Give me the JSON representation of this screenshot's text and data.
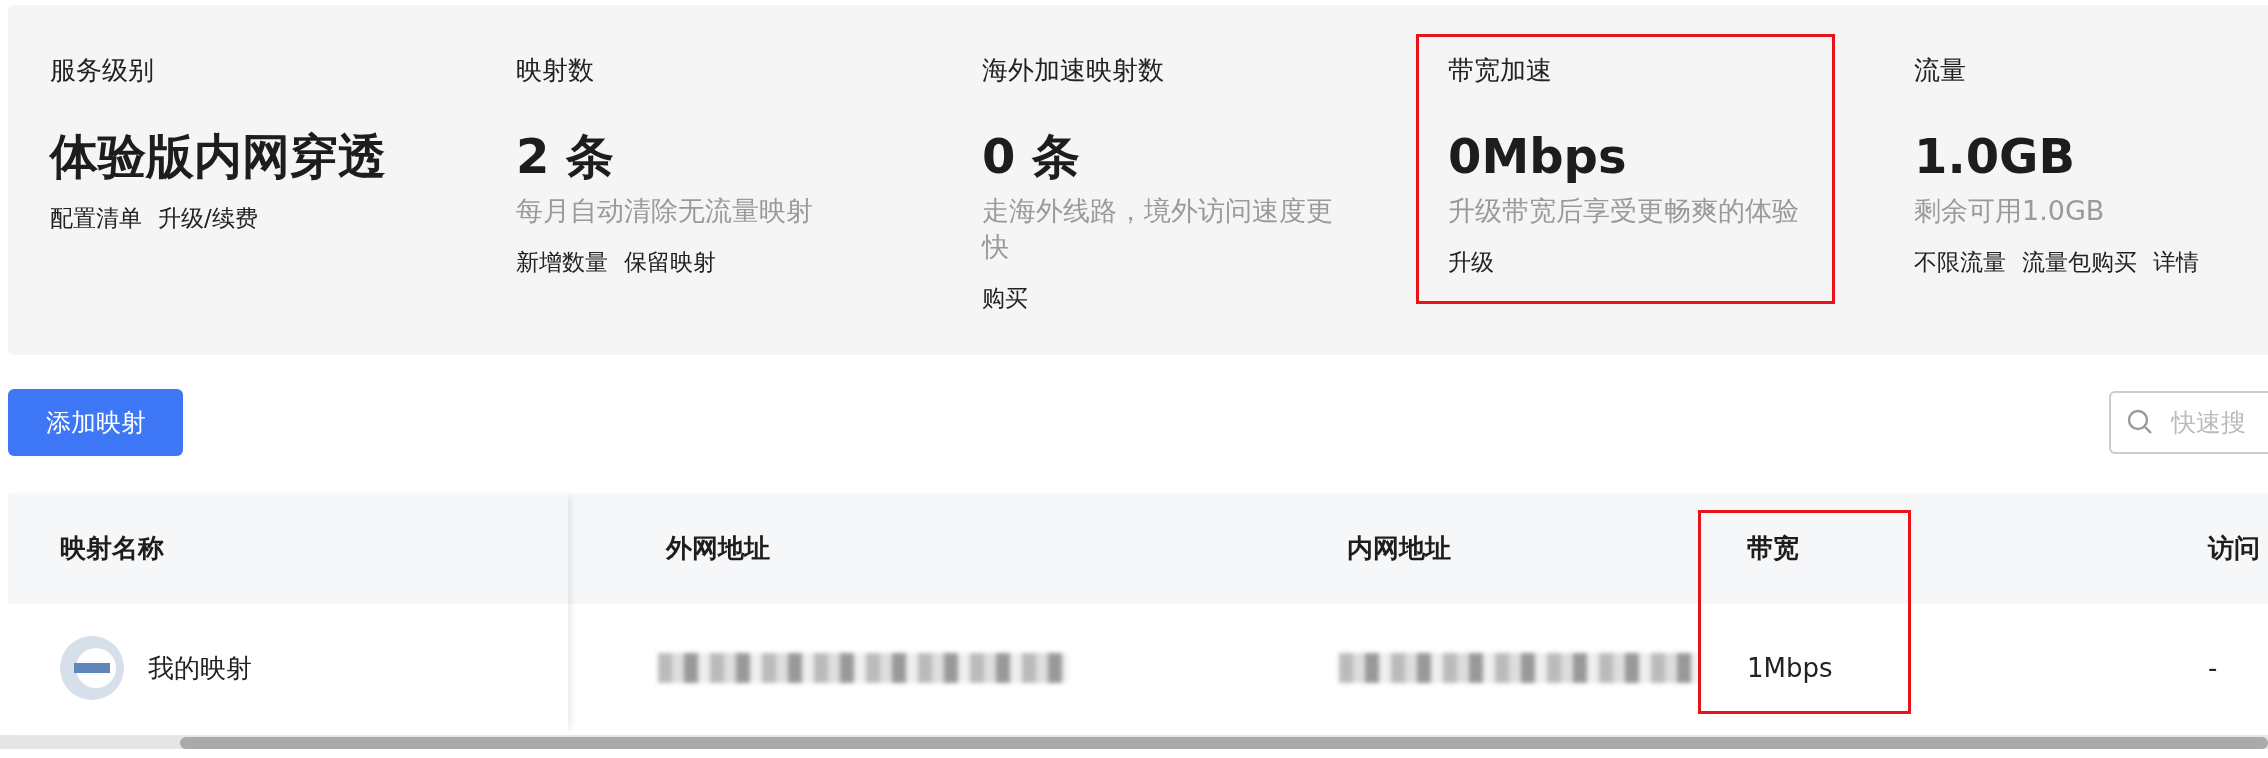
{
  "stats": [
    {
      "title": "服务级别",
      "value": "体验版内网穿透",
      "links": [
        "配置清单",
        "升级/续费"
      ],
      "annotated": false
    },
    {
      "title": "映射数",
      "value": "2 条",
      "description": "每月自动清除无流量映射",
      "links": [
        "新增数量",
        "保留映射"
      ],
      "annotated": false
    },
    {
      "title": "海外加速映射数",
      "value": "0 条",
      "description": "走海外线路，境外访问速度更快",
      "links": [
        "购买"
      ],
      "annotated": false
    },
    {
      "title": "带宽加速",
      "value": "0Mbps",
      "description": "升级带宽后享受更畅爽的体验",
      "links": [
        "升级"
      ],
      "annotated": true
    },
    {
      "title": "流量",
      "value": "1.0GB",
      "description": "剩余可用1.0GB",
      "links": [
        "不限流量",
        "流量包购买",
        "详情"
      ],
      "annotated": false
    }
  ],
  "add_button": "添加映射",
  "search": {
    "placeholder": "快速搜"
  },
  "table": {
    "columns": [
      {
        "label": "映射名称",
        "annotated": false
      },
      {
        "label": "外网地址",
        "annotated": false
      },
      {
        "label": "内网地址",
        "annotated": false
      },
      {
        "label": "带宽",
        "annotated": true
      },
      {
        "label": "访问",
        "annotated": false
      }
    ],
    "rows": [
      {
        "cells": [
          {
            "kind": "name",
            "text": "我的映射"
          },
          {
            "kind": "redacted"
          },
          {
            "kind": "redacted"
          },
          {
            "kind": "text",
            "text": "1Mbps"
          },
          {
            "kind": "text",
            "text": "-"
          }
        ]
      }
    ]
  }
}
